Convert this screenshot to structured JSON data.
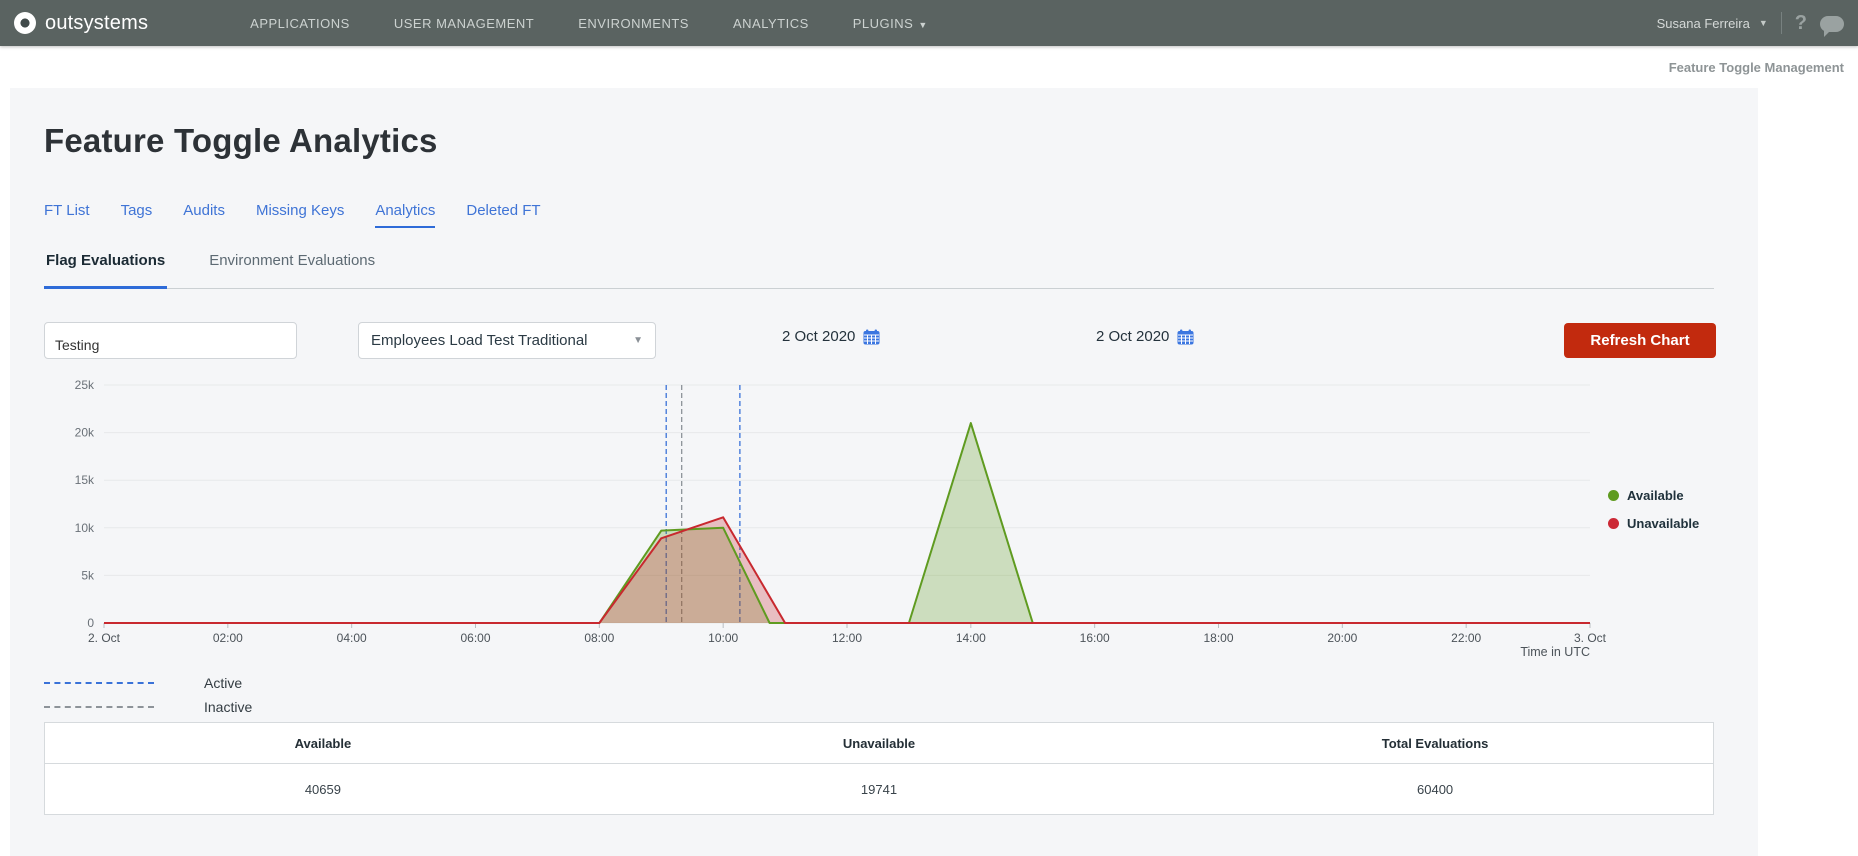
{
  "nav": {
    "brand": "outsystems",
    "items": [
      "APPLICATIONS",
      "USER MANAGEMENT",
      "ENVIRONMENTS",
      "ANALYTICS",
      "PLUGINS"
    ],
    "user": "Susana Ferreira",
    "help": "?"
  },
  "breadcrumb": "Feature Toggle Management",
  "page": {
    "title": "Feature Toggle Analytics",
    "tabs": [
      "FT List",
      "Tags",
      "Audits",
      "Missing Keys",
      "Analytics",
      "Deleted FT"
    ],
    "active_tab": "Analytics",
    "subtabs": [
      "Flag Evaluations",
      "Environment Evaluations"
    ],
    "active_subtab": "Flag Evaluations"
  },
  "filters": {
    "search_value": "Testing",
    "flag_selected": "Employees Load Test Traditional",
    "date_from": "2 Oct 2020",
    "date_to": "2 Oct 2020",
    "refresh_label": "Refresh Chart"
  },
  "ui_colors": {
    "navbar": "#5a6361",
    "accent_blue": "#2e6bd8",
    "button_red": "#c22a0e",
    "panel_bg": "#f5f6f8"
  },
  "chart_data": {
    "type": "area",
    "x_unit": "hours since 2 Oct 2020 00:00 UTC",
    "xlabel": "Time in UTC",
    "xlim": [
      0,
      24
    ],
    "ylim": [
      0,
      25000
    ],
    "grid": true,
    "x_tick_hours": [
      0,
      2,
      4,
      6,
      8,
      10,
      12,
      14,
      16,
      18,
      20,
      22,
      24
    ],
    "x_tick_labels": [
      "2. Oct",
      "02:00",
      "04:00",
      "06:00",
      "08:00",
      "10:00",
      "12:00",
      "14:00",
      "16:00",
      "18:00",
      "20:00",
      "22:00",
      "3. Oct"
    ],
    "y_tick_values": [
      0,
      5000,
      10000,
      15000,
      20000,
      25000
    ],
    "y_tick_labels": [
      "0",
      "5k",
      "10k",
      "15k",
      "20k",
      "25k"
    ],
    "series": [
      {
        "name": "Available",
        "color": "#5f9b20",
        "fill": "rgba(95,155,32,0.27)",
        "points": [
          [
            0,
            0
          ],
          [
            8,
            0
          ],
          [
            9,
            9700
          ],
          [
            9.3,
            9800
          ],
          [
            10,
            10000
          ],
          [
            10.75,
            0
          ],
          [
            13,
            0
          ],
          [
            14,
            21000
          ],
          [
            15,
            0
          ],
          [
            24,
            0
          ]
        ]
      },
      {
        "name": "Unavailable",
        "color": "#c8292f",
        "fill": "rgba(200,41,47,0.27)",
        "points": [
          [
            0,
            0
          ],
          [
            8,
            0
          ],
          [
            9,
            8900
          ],
          [
            10,
            11100
          ],
          [
            11,
            0
          ],
          [
            24,
            0
          ]
        ]
      }
    ],
    "annotations": [
      {
        "type": "vline",
        "x": 9.08,
        "style": "dashed",
        "color": "#3a72d8",
        "meaning": "Active"
      },
      {
        "type": "vline",
        "x": 9.33,
        "style": "dashed",
        "color": "#8d9399",
        "meaning": "Inactive"
      },
      {
        "type": "vline",
        "x": 10.27,
        "style": "dashed",
        "color": "#3a72d8",
        "meaning": "Active"
      }
    ],
    "legend": [
      {
        "label": "Available",
        "color": "#5f9b20"
      },
      {
        "label": "Unavailable",
        "color": "#cc2936"
      }
    ],
    "legend_position": "right"
  },
  "dash_legend": [
    {
      "label": "Active",
      "color": "#3a72d8"
    },
    {
      "label": "Inactive",
      "color": "#8d9399"
    }
  ],
  "summary_table": {
    "headers": [
      "Available",
      "Unavailable",
      "Total Evaluations"
    ],
    "values": [
      "40659",
      "19741",
      "60400"
    ]
  }
}
